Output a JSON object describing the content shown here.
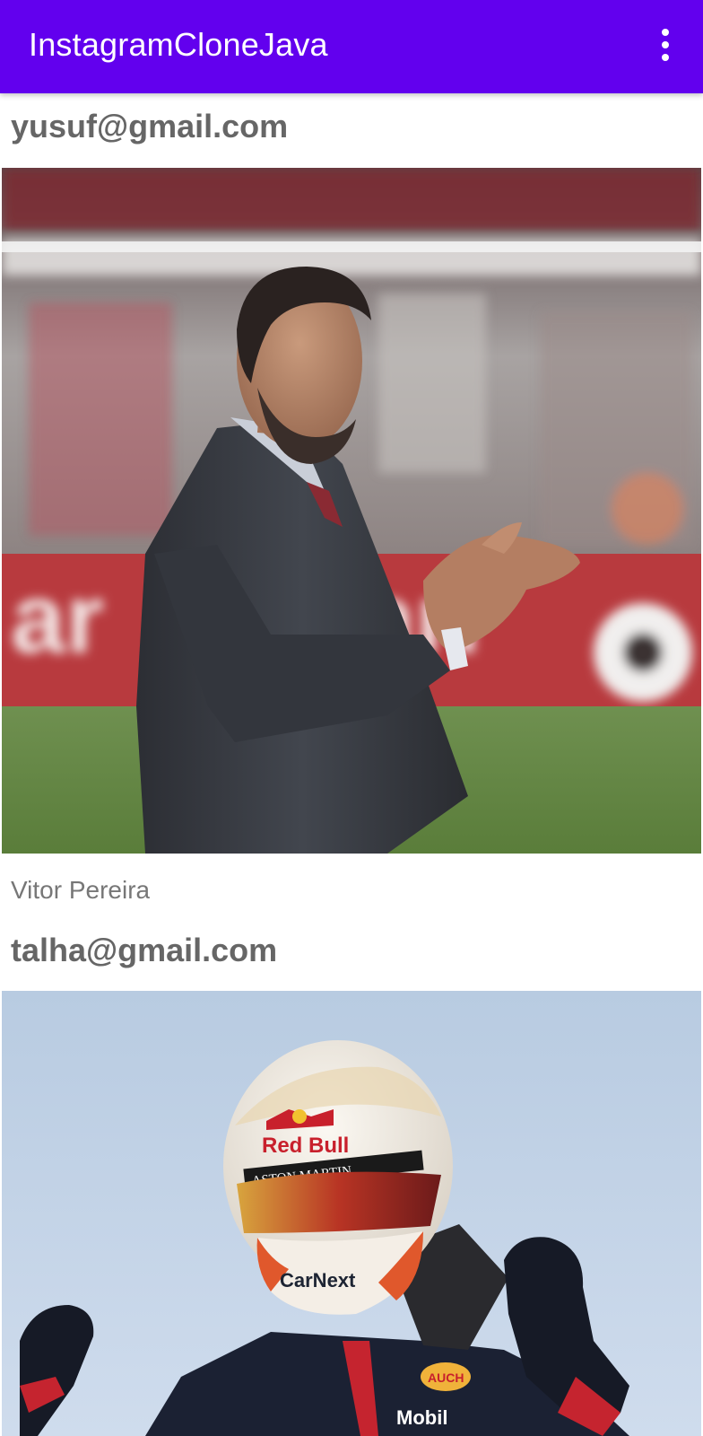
{
  "app_bar": {
    "title": "InstagramCloneJava",
    "background_color": "#6200EE",
    "overflow_icon": "more-vert-icon"
  },
  "posts": [
    {
      "email": "yusuf@gmail.com",
      "comment": "Vitor Pereira",
      "image": "photo-football-coach-clapping"
    },
    {
      "email": "talha@gmail.com",
      "comment": "",
      "image": "photo-f1-driver-helmet"
    }
  ]
}
